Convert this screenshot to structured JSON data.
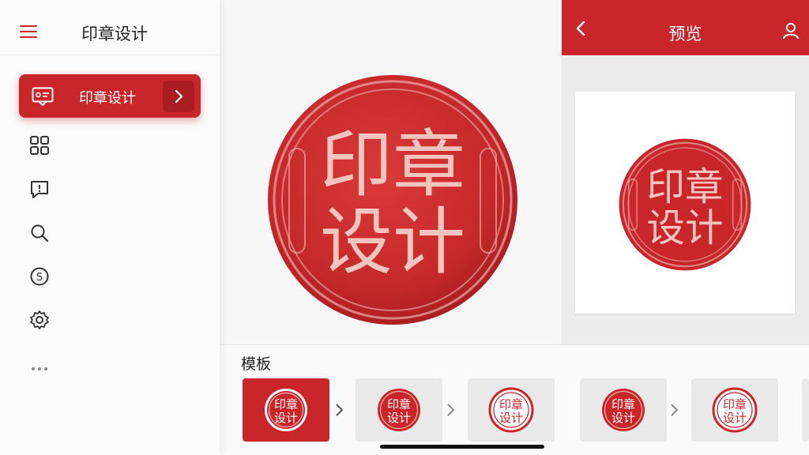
{
  "sidebar": {
    "title": "印章设计",
    "active_item": {
      "label": "印章设计"
    },
    "nav_icons": [
      "grid-icon",
      "chat-icon",
      "search-icon",
      "s-coin-icon",
      "gear-icon",
      "more-icon"
    ]
  },
  "seal": {
    "line1": "印章",
    "line2": "设计",
    "color": "#c8262a"
  },
  "preview": {
    "title": "预览"
  },
  "templates": {
    "title": "模板",
    "items": [
      {
        "line1": "印章",
        "line2": "设计",
        "selected": true
      },
      {
        "line1": "印章",
        "line2": "设计",
        "selected": false
      },
      {
        "line1": "印章",
        "line2": "设计",
        "selected": false
      },
      {
        "line1": "印章",
        "line2": "设计",
        "selected": false
      },
      {
        "line1": "印章",
        "line2": "设计",
        "selected": false
      }
    ]
  },
  "colors": {
    "accent": "#c8262a",
    "accent_dark": "#a91d21",
    "background": "#ededed"
  }
}
